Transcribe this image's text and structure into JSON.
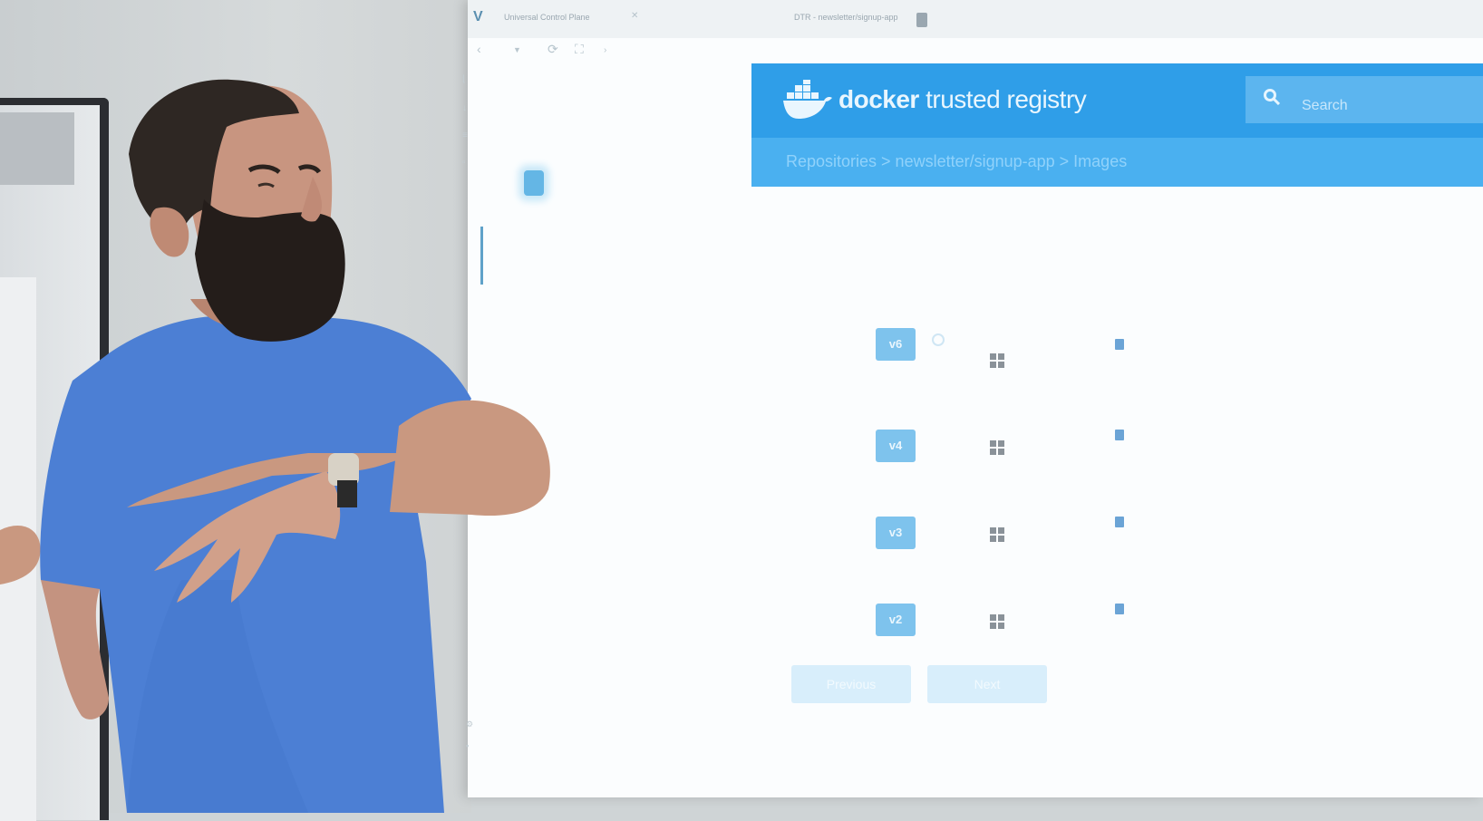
{
  "browser": {
    "tab1_title": "Universal Control Plane",
    "tab2_title": "DTR - newsletter/signup-app"
  },
  "registry": {
    "brand_strong": "docker",
    "brand_light": "trusted registry",
    "search_placeholder": "Search",
    "breadcrumb": "Repositories > newsletter/signup-app > Images"
  },
  "images": [
    {
      "tag": "v6"
    },
    {
      "tag": "v4"
    },
    {
      "tag": "v3"
    },
    {
      "tag": "v2"
    }
  ],
  "pager": {
    "previous_label": "Previous",
    "next_label": "Next"
  },
  "colors": {
    "accent": "#2f9ee8",
    "shirt": "#4c7fd4"
  }
}
